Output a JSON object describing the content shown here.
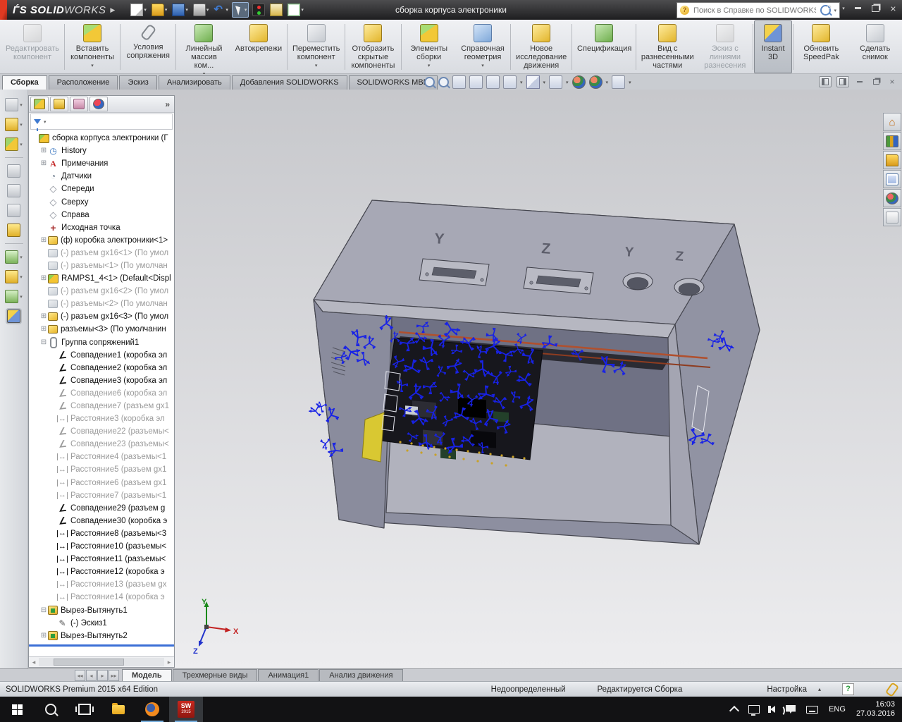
{
  "title_bar": {
    "app_name": "SOLIDWORKS",
    "logo_bold": "SOLID",
    "logo_light": "WORKS",
    "document_title": "сборка корпуса электроники",
    "search_placeholder": "Поиск в Справке по SOLIDWORKS",
    "quick_access": [
      {
        "name": "new-document-icon",
        "style": "qi-new",
        "dd": true
      },
      {
        "name": "open-icon",
        "style": "qi-open",
        "dd": true
      },
      {
        "name": "save-icon",
        "style": "qi-save",
        "dd": true
      },
      {
        "name": "print-icon",
        "style": "qi-print",
        "dd": true
      },
      {
        "name": "undo-icon",
        "style": "qi-undo",
        "glyph": "↶",
        "dd": true
      },
      {
        "name": "select-cursor-icon",
        "style": "qi-select",
        "dd": true,
        "pressed": true
      },
      {
        "name": "traffic-light-icon",
        "style": "qi-traffic"
      },
      {
        "name": "options-icon",
        "style": "qi-note"
      },
      {
        "name": "checklist-icon",
        "style": "qi-list",
        "dd": true
      }
    ]
  },
  "ribbon": {
    "buttons": [
      {
        "label": "Редактировать компонент",
        "icon": "edit-component",
        "disabled": true,
        "sep": true
      },
      {
        "label": "Вставить компоненты",
        "icon": "insert-components",
        "dd": true,
        "sep": true
      },
      {
        "label": "Условия сопряжения",
        "icon": "mate",
        "sep": true
      },
      {
        "label": "Линейный массив ком...",
        "icon": "linear-pattern",
        "dd": true
      },
      {
        "label": "Автокрепежи",
        "icon": "smart-fasteners",
        "sep": true
      },
      {
        "label": "Переместить компонент",
        "icon": "move-component",
        "dd": true,
        "sep": true
      },
      {
        "label": "Отобразить скрытые компоненты",
        "icon": "show-hidden",
        "sep": true
      },
      {
        "label": "Элементы сборки",
        "icon": "assembly-features",
        "dd": true
      },
      {
        "label": "Справочная геометрия",
        "icon": "reference-geometry",
        "dd": true,
        "sep": true
      },
      {
        "label": "Новое исследование движения",
        "icon": "motion-study",
        "sep": true
      },
      {
        "label": "Спецификация",
        "icon": "bill-of-materials",
        "sep": true
      },
      {
        "label": "Вид с разнесенными частями",
        "icon": "exploded-view"
      },
      {
        "label": "Эскиз с линиями разнесения",
        "icon": "explode-line-sketch",
        "disabled": true,
        "sep": true
      },
      {
        "label": "Instant 3D",
        "icon": "instant-3d",
        "active": true,
        "sep": true
      },
      {
        "label": "Обновить SpeedPak",
        "icon": "update-speedpak"
      },
      {
        "label": "Сделать снимок",
        "icon": "take-snapshot"
      }
    ]
  },
  "command_tabs": [
    {
      "label": "Сборка",
      "active": true
    },
    {
      "label": "Расположение",
      "active": false
    },
    {
      "label": "Эскиз",
      "active": false
    },
    {
      "label": "Анализировать",
      "active": false
    },
    {
      "label": "Добавления SOLIDWORKS",
      "active": false
    },
    {
      "label": "SOLIDWORKS MBD",
      "active": false
    }
  ],
  "view_toolbar": {
    "icons": [
      {
        "name": "zoom-fit-icon",
        "style": "vmag"
      },
      {
        "name": "zoom-area-icon",
        "style": "vmag"
      },
      {
        "name": "zoom-selection-icon",
        "style": "gen"
      },
      {
        "name": "previous-view-icon",
        "style": "gen"
      },
      {
        "name": "rotate-view-icon",
        "style": "gen"
      },
      {
        "name": "section-view-icon",
        "style": "gen",
        "dd": true
      },
      {
        "name": "view-orientation-icon",
        "style": "cube",
        "dd": true
      },
      {
        "name": "display-style-icon",
        "style": "gen",
        "dd": true
      },
      {
        "name": "edit-appearance-icon",
        "style": "ball"
      },
      {
        "name": "apply-scene-icon",
        "style": "ball",
        "dd": true
      },
      {
        "name": "view-settings-icon",
        "style": "gen",
        "dd": true
      }
    ]
  },
  "doc_window_controls": [
    "pane-left-icon",
    "pane-right-icon",
    "minimize-doc-icon",
    "restore-doc-icon",
    "close-doc-icon"
  ],
  "left_toolbar": {
    "icons": [
      {
        "name": "copy-appearance-icon",
        "style": "g",
        "dd": true
      },
      {
        "name": "component-icon",
        "style": "y",
        "dd": true
      },
      {
        "name": "appearance-sphere-icon",
        "style": "yg",
        "dd": true
      },
      {
        "name": "publish-icon",
        "style": "g"
      },
      {
        "name": "hide-component-icon",
        "style": "g"
      },
      {
        "name": "transparency-icon",
        "style": "g"
      },
      {
        "name": "magic-select-icon",
        "style": "y"
      },
      {
        "name": "pattern-grid-icon",
        "style": "gr",
        "dd": true
      },
      {
        "name": "sketch-tool-icon",
        "style": "y",
        "dd": true
      },
      {
        "name": "spline-icon",
        "style": "gr",
        "dd": true
      },
      {
        "name": "instant3d-icon",
        "style": "pressed"
      }
    ]
  },
  "feature_tree": {
    "header_tabs": [
      "featuremanager-tab",
      "propertymanager-tab",
      "configurationmanager-tab",
      "displaymanager-tab"
    ],
    "overflow_chevron": "»",
    "items": [
      {
        "label": "сборка корпуса электроники  (Г",
        "icon": "assembly",
        "level": 0,
        "exp": "none",
        "gray": false
      },
      {
        "label": "History",
        "icon": "history",
        "level": 1,
        "exp": "plus",
        "gray": false
      },
      {
        "label": "Примечания",
        "icon": "annotations",
        "level": 1,
        "exp": "plus",
        "gray": false
      },
      {
        "label": "Датчики",
        "icon": "sensors",
        "level": 1,
        "exp": "none",
        "gray": false
      },
      {
        "label": "Спереди",
        "icon": "plane",
        "level": 1,
        "exp": "none",
        "gray": false
      },
      {
        "label": "Сверху",
        "icon": "plane",
        "level": 1,
        "exp": "none",
        "gray": false
      },
      {
        "label": "Справа",
        "icon": "plane",
        "level": 1,
        "exp": "none",
        "gray": false
      },
      {
        "label": "Исходная точка",
        "icon": "origin",
        "level": 1,
        "exp": "none",
        "gray": false
      },
      {
        "label": "(ф) коробка электроники<1>",
        "icon": "part",
        "level": 1,
        "exp": "plus",
        "gray": false
      },
      {
        "label": "(-) разъем gx16<1> (По умол",
        "icon": "part-hidden",
        "level": 1,
        "exp": "none",
        "gray": true
      },
      {
        "label": "(-) разъемы<1> (По умолчан",
        "icon": "part-hidden",
        "level": 1,
        "exp": "none",
        "gray": true
      },
      {
        "label": "RAMPS1_4<1> (Default<Displ",
        "icon": "subassembly",
        "level": 1,
        "exp": "plus",
        "gray": false
      },
      {
        "label": "(-) разъем gx16<2> (По умол",
        "icon": "part-hidden",
        "level": 1,
        "exp": "none",
        "gray": true
      },
      {
        "label": "(-) разъемы<2> (По умолчан",
        "icon": "part-hidden",
        "level": 1,
        "exp": "none",
        "gray": true
      },
      {
        "label": "(-) разъем gx16<3> (По умол",
        "icon": "part",
        "level": 1,
        "exp": "plus",
        "gray": false
      },
      {
        "label": "разъемы<3> (По умолчанин",
        "icon": "part",
        "level": 1,
        "exp": "plus",
        "gray": false
      },
      {
        "label": "Группа сопряжений1",
        "icon": "mategroup",
        "level": 1,
        "exp": "minus",
        "gray": false
      },
      {
        "label": "Совпадение1 (коробка эл",
        "icon": "mate",
        "level": 2,
        "exp": "none",
        "gray": false
      },
      {
        "label": "Совпадение2 (коробка эл",
        "icon": "mate",
        "level": 2,
        "exp": "none",
        "gray": false
      },
      {
        "label": "Совпадение3 (коробка эл",
        "icon": "mate",
        "level": 2,
        "exp": "none",
        "gray": false
      },
      {
        "label": "Совпадение6 (коробка эл",
        "icon": "mate",
        "level": 2,
        "exp": "none",
        "gray": true
      },
      {
        "label": "Совпадение7 (разъем gx1",
        "icon": "mate",
        "level": 2,
        "exp": "none",
        "gray": true
      },
      {
        "label": "Расстояние3 (коробка эл",
        "icon": "distance",
        "level": 2,
        "exp": "none",
        "gray": true
      },
      {
        "label": "Совпадение22 (разъемы<",
        "icon": "mate",
        "level": 2,
        "exp": "none",
        "gray": true
      },
      {
        "label": "Совпадение23 (разъемы<",
        "icon": "mate",
        "level": 2,
        "exp": "none",
        "gray": true
      },
      {
        "label": "Расстояние4 (разъемы<1",
        "icon": "distance",
        "level": 2,
        "exp": "none",
        "gray": true
      },
      {
        "label": "Расстояние5 (разъем gx1",
        "icon": "distance",
        "level": 2,
        "exp": "none",
        "gray": true
      },
      {
        "label": "Расстояние6 (разъем gx1",
        "icon": "distance",
        "level": 2,
        "exp": "none",
        "gray": true
      },
      {
        "label": "Расстояние7 (разъемы<1",
        "icon": "distance",
        "level": 2,
        "exp": "none",
        "gray": true
      },
      {
        "label": "Совпадение29 (разъем g",
        "icon": "mate",
        "level": 2,
        "exp": "none",
        "gray": false
      },
      {
        "label": "Совпадение30 (коробка э",
        "icon": "mate",
        "level": 2,
        "exp": "none",
        "gray": false
      },
      {
        "label": "Расстояние8 (разъемы<3",
        "icon": "distance",
        "level": 2,
        "exp": "none",
        "gray": false
      },
      {
        "label": "Расстояние10 (разъемы<",
        "icon": "distance",
        "level": 2,
        "exp": "none",
        "gray": false
      },
      {
        "label": "Расстояние11 (разъемы<",
        "icon": "distance",
        "level": 2,
        "exp": "none",
        "gray": false
      },
      {
        "label": "Расстояние12 (коробка э",
        "icon": "distance",
        "level": 2,
        "exp": "none",
        "gray": false
      },
      {
        "label": "Расстояние13 (разъем gx",
        "icon": "distance",
        "level": 2,
        "exp": "none",
        "gray": true
      },
      {
        "label": "Расстояние14 (коробка э",
        "icon": "distance",
        "level": 2,
        "exp": "none",
        "gray": true
      },
      {
        "label": "Вырез-Вытянуть1",
        "icon": "cut-extrude",
        "level": 1,
        "exp": "minus",
        "gray": false
      },
      {
        "label": "(-) Эскиз1",
        "icon": "sketch",
        "level": 2,
        "exp": "none",
        "gray": false
      },
      {
        "label": "Вырез-Вытянуть2",
        "icon": "cut-extrude",
        "level": 1,
        "exp": "plus",
        "gray": false
      }
    ]
  },
  "task_pane_icons": [
    "home-icon",
    "design-library-icon",
    "file-explorer-icon",
    "view-palette-icon",
    "appearances-icon",
    "custom-properties-icon"
  ],
  "viewport": {
    "face_labels": [
      "Y",
      "Z",
      "Y",
      "Z"
    ],
    "triad_labels": {
      "x": "X",
      "y": "Y",
      "z": "Z"
    },
    "mate_marker_color": "#1822e6"
  },
  "doc_tabs": {
    "tabs": [
      {
        "label": "Модель",
        "active": true
      },
      {
        "label": "Трехмерные виды",
        "active": false
      },
      {
        "label": "Анимация1",
        "active": false
      },
      {
        "label": "Анализ движения",
        "active": false
      }
    ]
  },
  "status_bar": {
    "product": "SOLIDWORKS Premium 2015 x64 Edition",
    "state": "Недоопределенный",
    "mode": "Редактируется Сборка",
    "custom": "Настройка"
  },
  "taskbar": {
    "apps": [
      "start",
      "search",
      "task-view",
      "file-explorer",
      "firefox",
      "solidworks"
    ],
    "solidworks_badge": "SW",
    "solidworks_year": "2015",
    "language": "ENG",
    "time": "16:03",
    "date": "27.03.2016"
  }
}
